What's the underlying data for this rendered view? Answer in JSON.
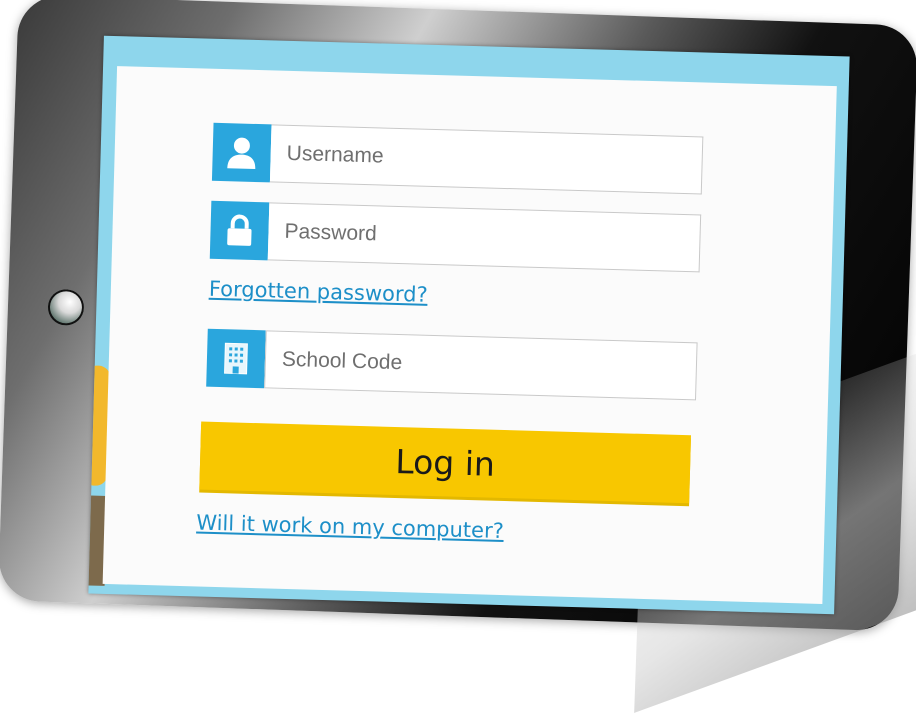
{
  "login_form": {
    "username_placeholder": "Username",
    "password_placeholder": "Password",
    "forgot_password_label": "Forgotten password?",
    "school_code_placeholder": "School Code",
    "login_button_label": "Log in",
    "compatibility_link_label": "Will it work on my computer?"
  },
  "icons": {
    "username": "user-icon",
    "password": "lock-icon",
    "school_code": "building-icon"
  },
  "colors": {
    "icon_background": "#2aa6dd",
    "login_button": "#f8c700",
    "link": "#1d8fc8",
    "screen_border": "#8ed6ec"
  }
}
